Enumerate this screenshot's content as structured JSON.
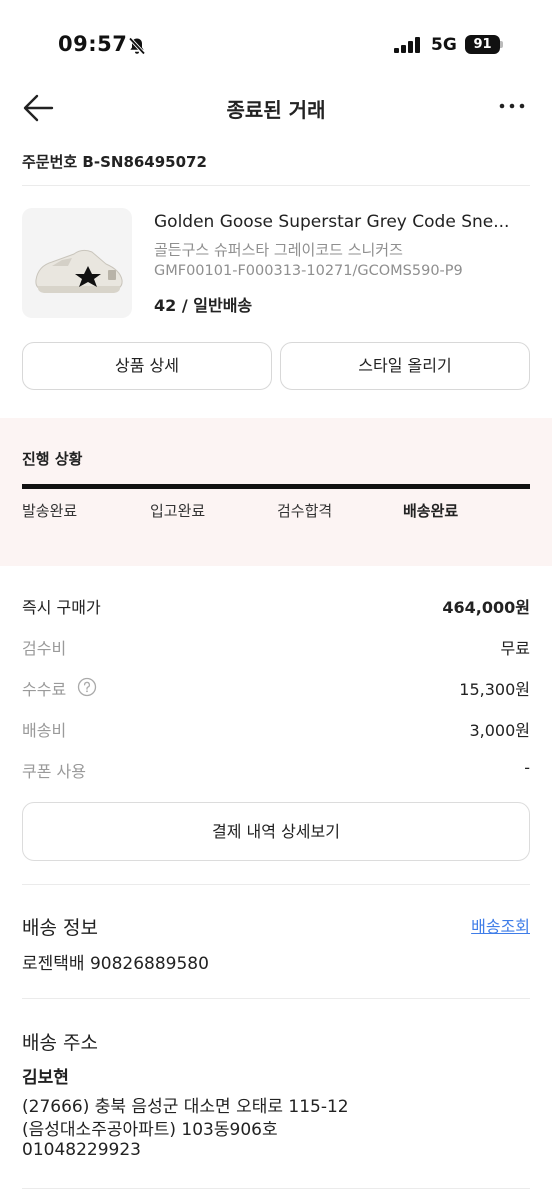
{
  "status_bar": {
    "time": "09:57",
    "network": "5G",
    "battery": "91",
    "icons": [
      "mute-bell-icon",
      "signal-icon"
    ]
  },
  "nav": {
    "title": "종료된 거래",
    "back_icon": "back-arrow-icon",
    "more_icon": "more-icon"
  },
  "order": {
    "number": "주문번호 B-SN86495072"
  },
  "product": {
    "name": "Golden Goose Superstar Grey Code Sne...",
    "name_kor": "골든구스 슈퍼스타 그레이코드 스니커즈",
    "code": "GMF00101-F000313-10271/GCOMS590-P9",
    "size": "42 / 일반배송"
  },
  "buttons": {
    "detail": "상품 상세",
    "style": "스타일 올리기"
  },
  "progress": {
    "title": "진행 상황",
    "steps": [
      {
        "label": "발송완료",
        "active": false
      },
      {
        "label": "입고완료",
        "active": false
      },
      {
        "label": "검수합격",
        "active": false
      },
      {
        "label": "배송완료",
        "active": true
      }
    ]
  },
  "price": {
    "rows": [
      {
        "label": "즉시 구매가",
        "value": "464,000원"
      },
      {
        "label": "검수비",
        "value": "무료"
      },
      {
        "label": "수수료",
        "value": "15,300원"
      },
      {
        "label": "배송비",
        "value": "3,000원"
      },
      {
        "label": "쿠폰 사용",
        "value": "-"
      }
    ],
    "detail_button": "결제 내역 상세보기"
  },
  "shipping": {
    "title": "배송 정보",
    "track_link": "배송조회",
    "info": "로젠택배 90826889580"
  },
  "address": {
    "title": "배송 주소",
    "name": "김보현",
    "line1": "(27666) 충북 음성군 대소면 오태로 115-12",
    "line2": "(음성대소주공아파트) 103동906호",
    "phone": "01048229923"
  },
  "colors": {
    "accent_link": "#3f7de8",
    "progress_bg": "#fcf4f3"
  }
}
